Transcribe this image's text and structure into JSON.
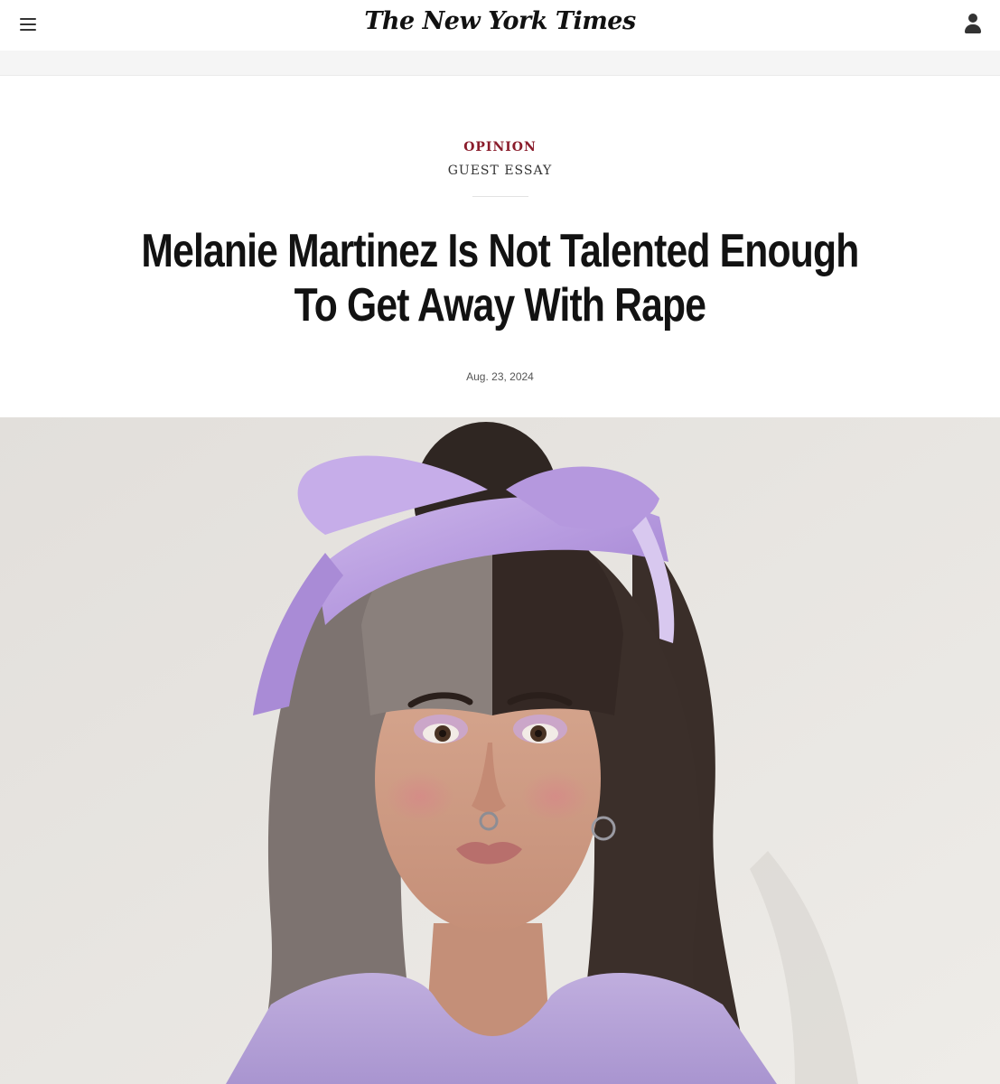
{
  "header": {
    "masthead": "The New York Times",
    "menu_icon": "hamburger-menu-icon",
    "account_icon": "user-account-icon"
  },
  "article": {
    "kicker": "OPINION",
    "label": "GUEST ESSAY",
    "headline_line1": "Melanie Martinez Is Not Talented Enough",
    "headline_line2": "To Get Away With Rape",
    "date": "Aug. 23, 2024"
  },
  "colors": {
    "kicker": "#8a1c2b",
    "headline": "#121212",
    "band": "#f5f5f5"
  }
}
